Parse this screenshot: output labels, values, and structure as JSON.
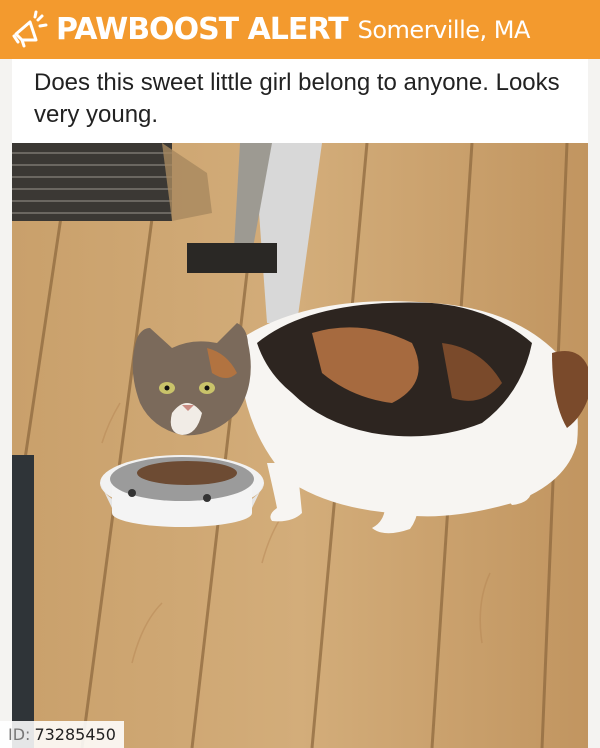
{
  "header": {
    "brand": "PAWBOOST ALERT",
    "location": "Somerville, MA",
    "background_color": "#f39a2e",
    "icon": "megaphone-icon"
  },
  "post": {
    "description": "Does this sweet little girl belong to anyone. Looks very young."
  },
  "photo": {
    "subject": "calico-cat"
  },
  "listing_id": {
    "prefix": "ID:",
    "value": "73285450"
  }
}
